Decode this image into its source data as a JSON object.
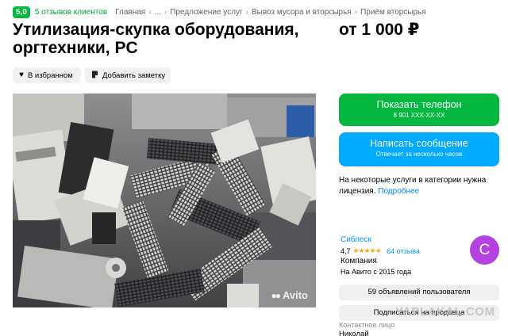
{
  "header": {
    "rating": "5,0",
    "reviews_link": "5 отзывов клиентов",
    "breadcrumbs": [
      "Главная",
      "...",
      "Предложение услуг",
      "Вывоз мусора и вторсырья",
      "Приём вторсырья"
    ],
    "breadcrumb_separator": "›"
  },
  "listing": {
    "title": "Утилизация-скупка оборудования, оргтехники, PC",
    "price": "от 1 000 ₽",
    "favorite_label": "В избранном",
    "note_label": "Добавить заметку",
    "photo_watermark": "Avito"
  },
  "actions": {
    "phone_label": "Показать телефон",
    "phone_number": "8 901 XXX-XX-XX",
    "message_label": "Написать сообщение",
    "message_sub": "Отвечает за несколько часов"
  },
  "license_note": {
    "text": "На некоторые услуги в категории нужна лицензия.",
    "link": "Подробнее"
  },
  "seller": {
    "name": "Сиблеск",
    "rating": "4,7",
    "stars": "★★★★★",
    "reviews": "64 отзыва",
    "type": "Компания",
    "since": "На Авито с 2015 года",
    "avatar_letter": "С",
    "ads_count_label": "59 объявлений пользователя",
    "subscribe_label": "Подписаться на продавца",
    "contact_label": "Контактное лицо",
    "contact_name": "Николай"
  },
  "site_watermark": "YAPLAKAL.COM",
  "colors": {
    "green": "#04b83f",
    "blue": "#00aaff",
    "link": "#0099f7",
    "avatar": "#b542e0",
    "stars": "#ffa600"
  },
  "icons": {
    "favorite": "heart-icon",
    "note": "note-icon"
  }
}
